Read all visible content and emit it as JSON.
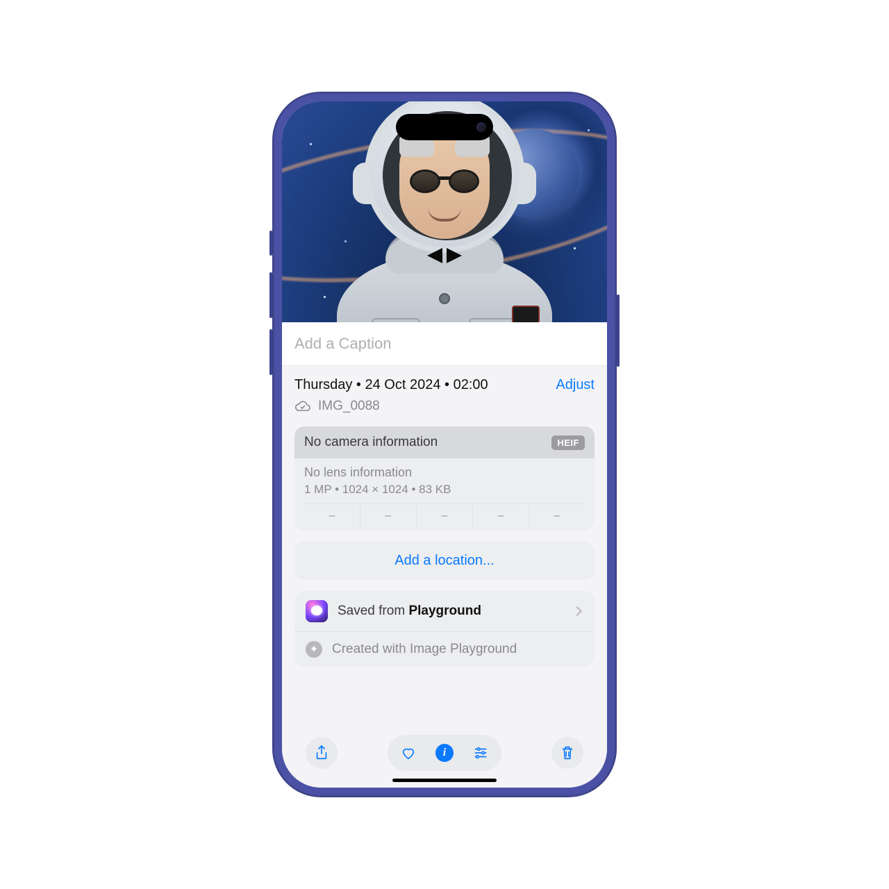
{
  "caption": {
    "placeholder": "Add a Caption"
  },
  "meta": {
    "date": "Thursday • 24 Oct 2024 • 02:00",
    "adjust": "Adjust",
    "filename": "IMG_0088"
  },
  "camera": {
    "title": "No camera information",
    "format": "HEIF",
    "lens": "No lens information",
    "specs": "1 MP • 1024 × 1024 • 83 KB",
    "dashes": [
      "–",
      "–",
      "–",
      "–",
      "–"
    ]
  },
  "location": {
    "label": "Add a location..."
  },
  "source": {
    "prefix": "Saved from ",
    "app": "Playground",
    "created": "Created with Image Playground"
  },
  "toolbar": {
    "share": "share",
    "favorite": "favorite",
    "info": "info",
    "adjust": "adjust",
    "delete": "delete"
  }
}
